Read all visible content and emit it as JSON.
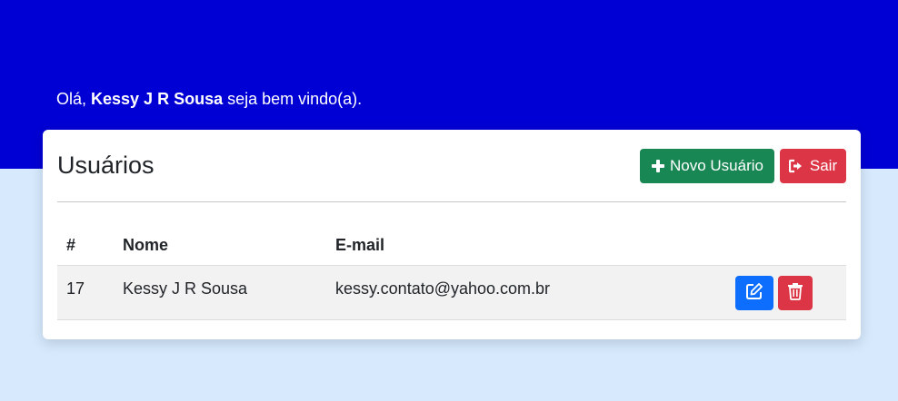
{
  "greeting": {
    "prefix": "Olá, ",
    "user_name": "Kessy J R Sousa",
    "suffix": " seja bem vindo(a)."
  },
  "card": {
    "title": "Usuários",
    "new_user_label": "Novo Usuário",
    "exit_label": "Sair"
  },
  "table": {
    "headers": [
      "#",
      "Nome",
      "E-mail"
    ],
    "rows": [
      {
        "id": "17",
        "name": "Kessy J R Sousa",
        "email": "kessy.contato@yahoo.com.br"
      }
    ]
  },
  "icons": {
    "new_user": "plus-icon",
    "exit": "sign-out-icon",
    "edit": "edit-icon",
    "delete": "trash-icon"
  },
  "colors": {
    "hero": "#0000d4",
    "page_bg": "#d6e9fd",
    "success": "#198754",
    "danger": "#dc3545",
    "primary": "#0d6efd"
  }
}
